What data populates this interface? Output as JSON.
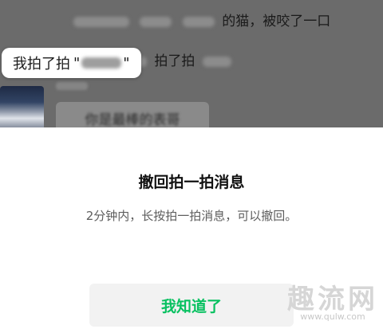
{
  "chat": {
    "line1_text": "的猫，被咬了一口",
    "line2_text": "拍了拍",
    "tooltip_prefix": "我拍了拍",
    "tooltip_quote_open": "\"",
    "tooltip_quote_close": "\"",
    "bubble_text": "你是最棒的表哥"
  },
  "dialog": {
    "title": "撤回拍一拍消息",
    "description": "2分钟内，长按拍一拍消息，可以撤回。",
    "confirm_label": "我知道了"
  },
  "watermark": {
    "text": "趣流网",
    "url": "www.qulw.com"
  },
  "colors": {
    "accent": "#07c160",
    "overlay": "#6b6b6b",
    "button_bg": "#f2f2f2"
  }
}
